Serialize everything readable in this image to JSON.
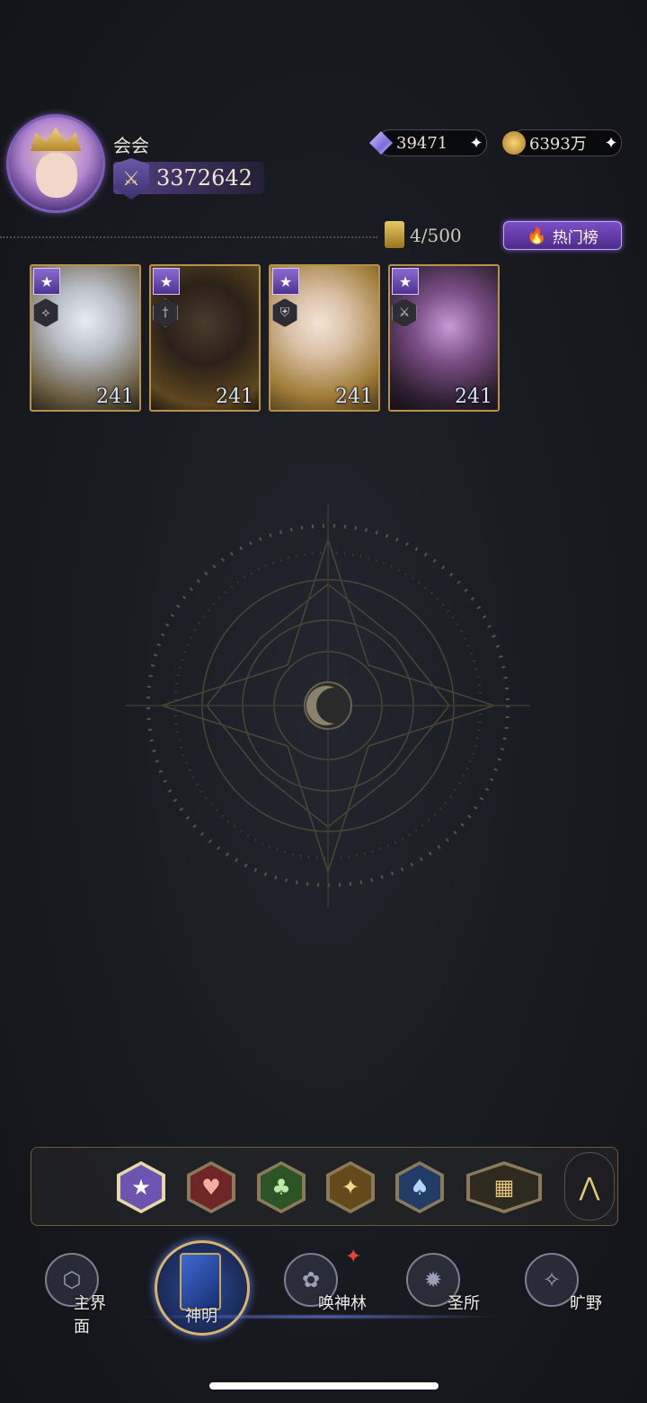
{
  "player": {
    "name": "会会",
    "power": "3372642",
    "avatar_icon": "goddess-portrait"
  },
  "currencies": [
    {
      "icon": "star-gem-icon",
      "value": "39471"
    },
    {
      "icon": "gold-coin-icon",
      "value": "6393万"
    }
  ],
  "collection": {
    "capacity": "4/500",
    "hot_button": "热门榜"
  },
  "cards": [
    {
      "level": "241",
      "type_icon": "claw-icon",
      "art": "silver-haired-god",
      "colors": [
        "#cfd3da",
        "#7b6a4c"
      ]
    },
    {
      "level": "241",
      "type_icon": "dagger-icon",
      "art": "dark-skinned-god",
      "colors": [
        "#3a2b1f",
        "#8a6a2c"
      ]
    },
    {
      "level": "241",
      "type_icon": "shield-icon",
      "art": "golden-goddess",
      "colors": [
        "#e8d7c5",
        "#b68a3e"
      ]
    },
    {
      "level": "241",
      "type_icon": "crossed-swords-icon",
      "art": "dark-haired-goddess",
      "colors": [
        "#5b3b5e",
        "#a46fb8"
      ]
    }
  ],
  "filters": [
    {
      "name": "star-filter",
      "symbol": "★",
      "color": "#7a5fc0",
      "fg": "#ffffff"
    },
    {
      "name": "heart-filter",
      "symbol": "♥",
      "color": "#7a2a2a",
      "fg": "#f3b0a0"
    },
    {
      "name": "club-filter",
      "symbol": "♣",
      "color": "#2f5a2a",
      "fg": "#bfe8a8"
    },
    {
      "name": "diamond-filter",
      "symbol": "✦",
      "color": "#6a5020",
      "fg": "#f2d88a"
    },
    {
      "name": "spade-filter",
      "symbol": "♠",
      "color": "#24406e",
      "fg": "#b7d3ff"
    },
    {
      "name": "grid-filter",
      "symbol": "▦",
      "color": "#3a3526",
      "fg": "#e3c67a"
    }
  ],
  "nav": [
    {
      "label": "主界面",
      "icon": "main-realm-icon"
    },
    {
      "label": "神明",
      "icon": "deity-book-icon",
      "active": true
    },
    {
      "label": "唤神林",
      "icon": "summon-tree-icon"
    },
    {
      "label": "圣所",
      "icon": "sanctuary-icon"
    },
    {
      "label": "旷野",
      "icon": "compass-icon"
    }
  ],
  "accent": "#b89248"
}
